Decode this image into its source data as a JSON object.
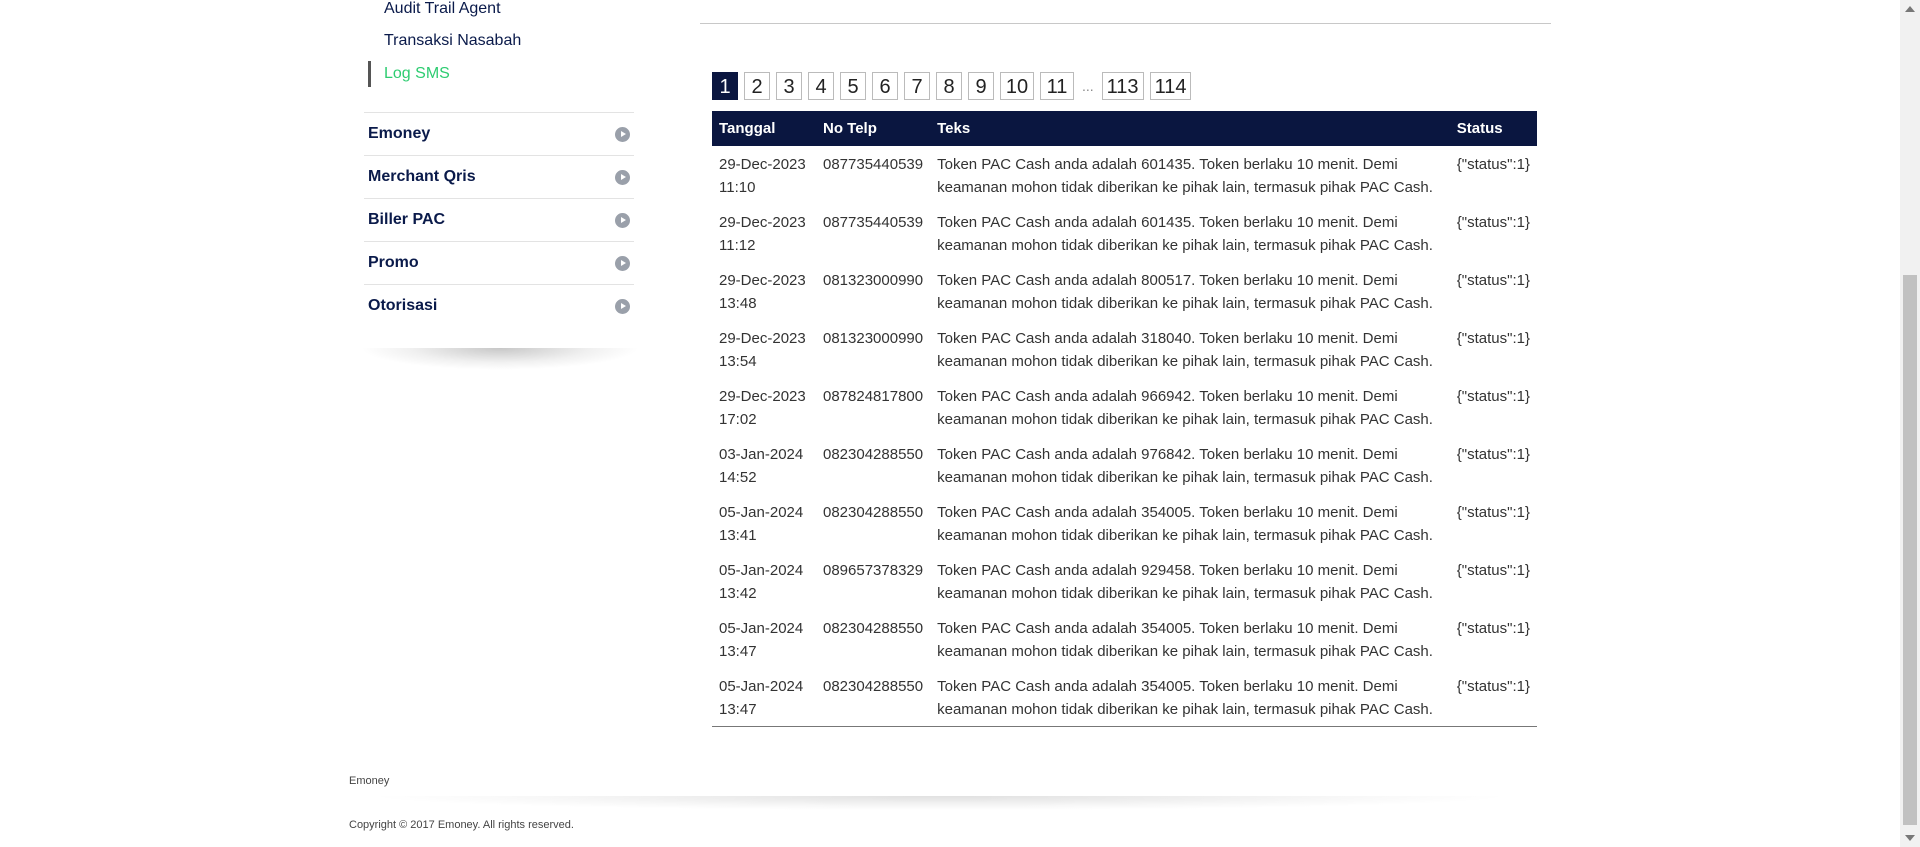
{
  "sidebar": {
    "sub_items": [
      "Audit Trail Agent",
      "Transaksi Nasabah",
      "Log SMS"
    ],
    "active_sub_item": "Log SMS",
    "menu": [
      "Emoney",
      "Merchant Qris",
      "Biller PAC",
      "Promo",
      "Otorisasi"
    ]
  },
  "pagination": {
    "pages": [
      "1",
      "2",
      "3",
      "4",
      "5",
      "6",
      "7",
      "8",
      "9",
      "10",
      "11"
    ],
    "ellipsis": "...",
    "last_pages": [
      "113",
      "114"
    ],
    "current": "1"
  },
  "table": {
    "headers": [
      "Tanggal",
      "No Telp",
      "Teks",
      "Status"
    ],
    "rows": [
      {
        "tanggal": "29-Dec-2023 11:10",
        "telp": "087735440539",
        "teks": "Token PAC Cash anda adalah 601435. Token berlaku 10 menit. Demi keamanan mohon tidak diberikan ke pihak lain, termasuk pihak PAC Cash.",
        "status": "{\"status\":1}"
      },
      {
        "tanggal": "29-Dec-2023 11:12",
        "telp": "087735440539",
        "teks": "Token PAC Cash anda adalah 601435. Token berlaku 10 menit. Demi keamanan mohon tidak diberikan ke pihak lain, termasuk pihak PAC Cash.",
        "status": "{\"status\":1}"
      },
      {
        "tanggal": "29-Dec-2023 13:48",
        "telp": "081323000990",
        "teks": "Token PAC Cash anda adalah 800517. Token berlaku 10 menit. Demi keamanan mohon tidak diberikan ke pihak lain, termasuk pihak PAC Cash.",
        "status": "{\"status\":1}"
      },
      {
        "tanggal": "29-Dec-2023 13:54",
        "telp": "081323000990",
        "teks": "Token PAC Cash anda adalah 318040. Token berlaku 10 menit. Demi keamanan mohon tidak diberikan ke pihak lain, termasuk pihak PAC Cash.",
        "status": "{\"status\":1}"
      },
      {
        "tanggal": "29-Dec-2023 17:02",
        "telp": "087824817800",
        "teks": "Token PAC Cash anda adalah 966942. Token berlaku 10 menit. Demi keamanan mohon tidak diberikan ke pihak lain, termasuk pihak PAC Cash.",
        "status": "{\"status\":1}"
      },
      {
        "tanggal": "03-Jan-2024 14:52",
        "telp": "082304288550",
        "teks": "Token PAC Cash anda adalah 976842. Token berlaku 10 menit. Demi keamanan mohon tidak diberikan ke pihak lain, termasuk pihak PAC Cash.",
        "status": "{\"status\":1}"
      },
      {
        "tanggal": "05-Jan-2024 13:41",
        "telp": "082304288550",
        "teks": "Token PAC Cash anda adalah 354005. Token berlaku 10 menit. Demi keamanan mohon tidak diberikan ke pihak lain, termasuk pihak PAC Cash.",
        "status": "{\"status\":1}"
      },
      {
        "tanggal": "05-Jan-2024 13:42",
        "telp": "089657378329",
        "teks": "Token PAC Cash anda adalah 929458. Token berlaku 10 menit. Demi keamanan mohon tidak diberikan ke pihak lain, termasuk pihak PAC Cash.",
        "status": "{\"status\":1}"
      },
      {
        "tanggal": "05-Jan-2024 13:47",
        "telp": "082304288550",
        "teks": "Token PAC Cash anda adalah 354005. Token berlaku 10 menit. Demi keamanan mohon tidak diberikan ke pihak lain, termasuk pihak PAC Cash.",
        "status": "{\"status\":1}"
      },
      {
        "tanggal": "05-Jan-2024 13:47",
        "telp": "082304288550",
        "teks": "Token PAC Cash anda adalah 354005. Token berlaku 10 menit. Demi keamanan mohon tidak diberikan ke pihak lain, termasuk pihak PAC Cash.",
        "status": "{\"status\":1}"
      }
    ]
  },
  "footer": {
    "brand": "Emoney",
    "copyright": "Copyright © 2017 Emoney. All rights reserved."
  },
  "colors": {
    "header_bg": "#0a1640",
    "active_link": "#2ecc71",
    "menu_text": "#0a1a4a"
  }
}
